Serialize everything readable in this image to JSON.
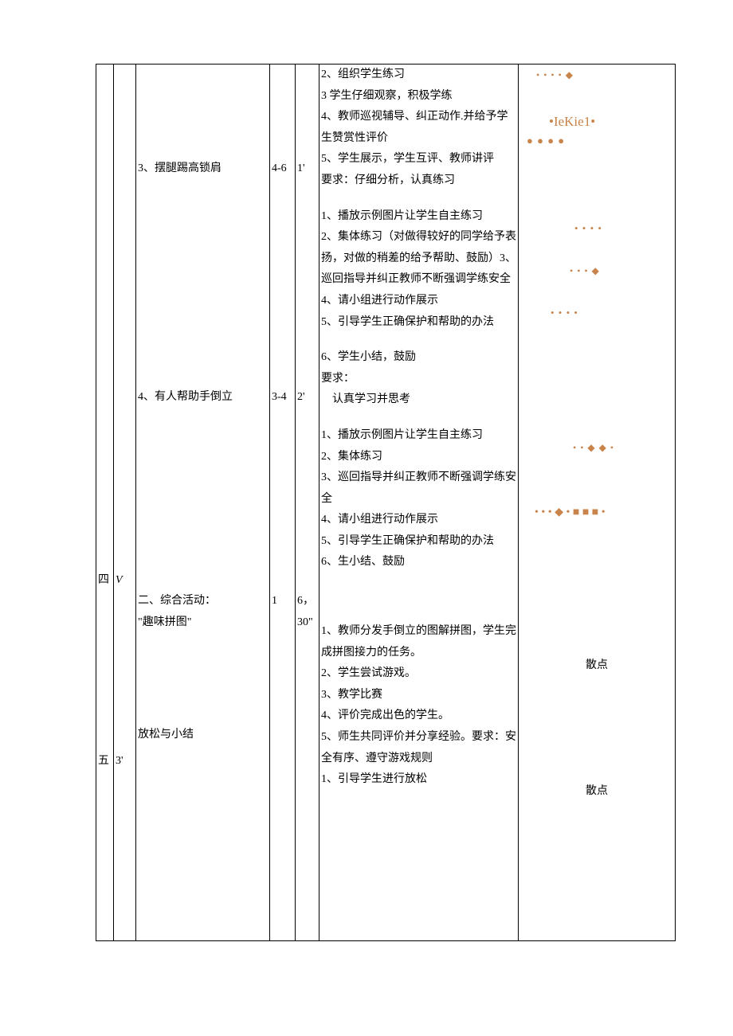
{
  "rows": {
    "four": {
      "num": "四",
      "sym": "V"
    },
    "five": {
      "num": "五",
      "sym": "3'"
    }
  },
  "activities": {
    "a3": {
      "label": "3、摆腿踢高锁肩",
      "reps": "4-6",
      "time": "1'"
    },
    "a4": {
      "label": "4、有人帮助手倒立",
      "reps": "3-4",
      "time": "2'"
    },
    "a5": {
      "title": "二、综合活动：",
      "sub": "\"趣味拼图\"",
      "reps": "1",
      "time": "6，30\""
    },
    "a6": {
      "label": "放松与小结"
    }
  },
  "contentBlocks": {
    "b1": {
      "l1": "2、组织学生练习",
      "l2": "3 学生仔细观察，积极学练",
      "l3": "4、教师巡视辅导、纠正动作.并给予学生赞赏性评价",
      "l4": "5、学生展示，学生互评、教师讲评",
      "l5": "要求：仔细分析，认真练习"
    },
    "b2": {
      "l1": "1、播放示例图片让学生自主练习",
      "l2": "2、集体练习（对做得较好的同学给予表扬，对做的稍差的给予帮助、鼓励）3、巡回指导并纠正教师不断强调学练安全",
      "l3": "4、请小组进行动作展示",
      "l4": "5、引导学生正确保护和帮助的办法"
    },
    "b3": {
      "l1": "6、学生小结，鼓励",
      "l2": "要求：",
      "l3": "认真学习并思考"
    },
    "b4": {
      "l1": "1、播放示例图片让学生自主练习",
      "l2": "2、集体练习",
      "l3": "3、巡回指导并纠正教师不断强调学练安全",
      "l4": "4、请小组进行动作展示",
      "l5": "5、引导学生正确保护和帮助的办法",
      "l6": "6、生小结、鼓励"
    },
    "b5": {
      "l1": "1、教师分发手倒立的图解拼图，学生完成拼图接力的任务。",
      "l2": "2、学生尝试游戏。",
      "l3": "3、教学比赛",
      "l4": "4、评价完成出色的学生。",
      "l5": "5、师生共同评价并分享经验。要求：安全有序、遵守游戏规则",
      "l6": "1、引导学生进行放松"
    }
  },
  "diagram": {
    "brand": "•IeKie1•",
    "scatter1": "散点",
    "scatter2": "散点"
  }
}
